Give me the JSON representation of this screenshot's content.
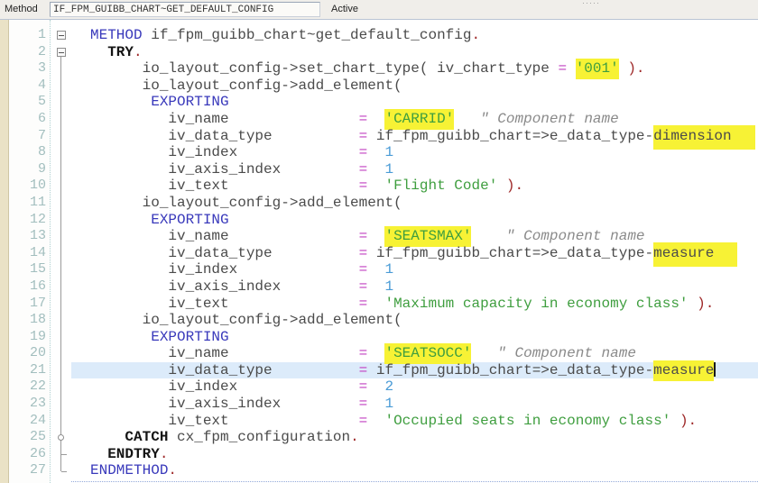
{
  "header": {
    "field_label": "Method",
    "field_value": "IF_FPM_GUIBB_CHART~GET_DEFAULT_CONFIG",
    "status": "Active",
    "splitter_dots": "·····"
  },
  "editor": {
    "active_line": 21,
    "colors": {
      "keyword": "#3939bb",
      "keyword_bold": "#141414",
      "identifier": "#4b4b4b",
      "string": "#3f9e3f",
      "number": "#4a9bd6",
      "operator": "#c240c2",
      "statement_end": "#9e2828",
      "comment": "#8a8a8a",
      "occurrence_highlight": "#f7f235",
      "active_line_bg": "#dcebfa",
      "line_number": "#a2bebe"
    },
    "fold": {
      "scope_line": {
        "from_line": 2,
        "to_line": 27
      },
      "markers": [
        {
          "line": 1,
          "type": "box"
        },
        {
          "line": 2,
          "type": "box"
        },
        {
          "line": 25,
          "type": "circle"
        },
        {
          "line": 26,
          "type": "tick"
        },
        {
          "line": 27,
          "type": "tick"
        }
      ]
    },
    "lines": [
      {
        "num": 1,
        "tokens": [
          {
            "c": "kw",
            "s": "METHOD"
          },
          {
            "c": "id",
            "s": " if_fpm_guibb_chart~get_default_config"
          },
          {
            "c": "dot",
            "s": "."
          }
        ]
      },
      {
        "num": 2,
        "tokens": [
          {
            "c": "kwb",
            "s": "  TRY"
          },
          {
            "c": "dot",
            "s": "."
          }
        ]
      },
      {
        "num": 3,
        "tokens": [
          {
            "c": "id",
            "s": "      io_layout_config->set_chart_type( iv_chart_type "
          },
          {
            "c": "op",
            "s": "="
          },
          {
            "c": "id",
            "s": " "
          },
          {
            "c": "str",
            "s": "'001'",
            "h": 1
          },
          {
            "c": "id",
            "s": " "
          },
          {
            "c": "dot",
            "s": ")."
          }
        ]
      },
      {
        "num": 4,
        "tokens": [
          {
            "c": "id",
            "s": "      io_layout_config->add_element("
          }
        ]
      },
      {
        "num": 5,
        "tokens": [
          {
            "c": "kw",
            "s": "       EXPORTING"
          }
        ]
      },
      {
        "num": 6,
        "tokens": [
          {
            "c": "id",
            "s": "         iv_name               "
          },
          {
            "c": "op",
            "s": "="
          },
          {
            "c": "id",
            "s": "  "
          },
          {
            "c": "str",
            "s": "'CARRID'",
            "h": 1
          },
          {
            "c": "id",
            "s": "   "
          },
          {
            "c": "cmt",
            "s": "\" Component name"
          }
        ]
      },
      {
        "num": 7,
        "tokens": [
          {
            "c": "id",
            "s": "         iv_data_type          "
          },
          {
            "c": "op",
            "s": "="
          },
          {
            "c": "id",
            "s": " if_fpm_guibb_chart=>e_data_type-"
          },
          {
            "c": "id",
            "s": "dimension",
            "h": 2
          }
        ]
      },
      {
        "num": 8,
        "tokens": [
          {
            "c": "id",
            "s": "         iv_index              "
          },
          {
            "c": "op",
            "s": "="
          },
          {
            "c": "id",
            "s": "  "
          },
          {
            "c": "num",
            "s": "1"
          }
        ]
      },
      {
        "num": 9,
        "tokens": [
          {
            "c": "id",
            "s": "         iv_axis_index         "
          },
          {
            "c": "op",
            "s": "="
          },
          {
            "c": "id",
            "s": "  "
          },
          {
            "c": "num",
            "s": "1"
          }
        ]
      },
      {
        "num": 10,
        "tokens": [
          {
            "c": "id",
            "s": "         iv_text               "
          },
          {
            "c": "op",
            "s": "="
          },
          {
            "c": "id",
            "s": "  "
          },
          {
            "c": "str",
            "s": "'Flight Code'"
          },
          {
            "c": "id",
            "s": " "
          },
          {
            "c": "dot",
            "s": ")."
          }
        ]
      },
      {
        "num": 11,
        "tokens": [
          {
            "c": "id",
            "s": "      io_layout_config->add_element("
          }
        ]
      },
      {
        "num": 12,
        "tokens": [
          {
            "c": "kw",
            "s": "       EXPORTING"
          }
        ]
      },
      {
        "num": 13,
        "tokens": [
          {
            "c": "id",
            "s": "         iv_name               "
          },
          {
            "c": "op",
            "s": "="
          },
          {
            "c": "id",
            "s": "  "
          },
          {
            "c": "str",
            "s": "'SEATSMAX'",
            "h": 1
          },
          {
            "c": "id",
            "s": "    "
          },
          {
            "c": "cmt",
            "s": "\" Component name"
          }
        ]
      },
      {
        "num": 14,
        "tokens": [
          {
            "c": "id",
            "s": "         iv_data_type          "
          },
          {
            "c": "op",
            "s": "="
          },
          {
            "c": "id",
            "s": " if_fpm_guibb_chart=>e_data_type-"
          },
          {
            "c": "id",
            "s": "measure",
            "h": 2
          }
        ]
      },
      {
        "num": 15,
        "tokens": [
          {
            "c": "id",
            "s": "         iv_index              "
          },
          {
            "c": "op",
            "s": "="
          },
          {
            "c": "id",
            "s": "  "
          },
          {
            "c": "num",
            "s": "1"
          }
        ]
      },
      {
        "num": 16,
        "tokens": [
          {
            "c": "id",
            "s": "         iv_axis_index         "
          },
          {
            "c": "op",
            "s": "="
          },
          {
            "c": "id",
            "s": "  "
          },
          {
            "c": "num",
            "s": "1"
          }
        ]
      },
      {
        "num": 17,
        "tokens": [
          {
            "c": "id",
            "s": "         iv_text               "
          },
          {
            "c": "op",
            "s": "="
          },
          {
            "c": "id",
            "s": "  "
          },
          {
            "c": "str",
            "s": "'Maximum capacity in economy class'"
          },
          {
            "c": "id",
            "s": " "
          },
          {
            "c": "dot",
            "s": ")."
          }
        ]
      },
      {
        "num": 18,
        "tokens": [
          {
            "c": "id",
            "s": "      io_layout_config->add_element("
          }
        ]
      },
      {
        "num": 19,
        "tokens": [
          {
            "c": "kw",
            "s": "       EXPORTING"
          }
        ]
      },
      {
        "num": 20,
        "tokens": [
          {
            "c": "id",
            "s": "         iv_name               "
          },
          {
            "c": "op",
            "s": "="
          },
          {
            "c": "id",
            "s": "  "
          },
          {
            "c": "str",
            "s": "'SEATSOCC'",
            "h": 1
          },
          {
            "c": "id",
            "s": "   "
          },
          {
            "c": "cmt",
            "s": "\" Component name"
          }
        ]
      },
      {
        "num": 21,
        "tokens": [
          {
            "c": "id",
            "s": "         iv_data_type          "
          },
          {
            "c": "op",
            "s": "="
          },
          {
            "c": "id",
            "s": " if_fpm_guibb_chart=>e_data_type-"
          },
          {
            "c": "id",
            "s": "measure",
            "h": 1,
            "cur": 1
          }
        ]
      },
      {
        "num": 22,
        "tokens": [
          {
            "c": "id",
            "s": "         iv_index              "
          },
          {
            "c": "op",
            "s": "="
          },
          {
            "c": "id",
            "s": "  "
          },
          {
            "c": "num",
            "s": "2"
          }
        ]
      },
      {
        "num": 23,
        "tokens": [
          {
            "c": "id",
            "s": "         iv_axis_index         "
          },
          {
            "c": "op",
            "s": "="
          },
          {
            "c": "id",
            "s": "  "
          },
          {
            "c": "num",
            "s": "1"
          }
        ]
      },
      {
        "num": 24,
        "tokens": [
          {
            "c": "id",
            "s": "         iv_text               "
          },
          {
            "c": "op",
            "s": "="
          },
          {
            "c": "id",
            "s": "  "
          },
          {
            "c": "str",
            "s": "'Occupied seats in economy class'"
          },
          {
            "c": "id",
            "s": " "
          },
          {
            "c": "dot",
            "s": ")."
          }
        ]
      },
      {
        "num": 25,
        "tokens": [
          {
            "c": "kwb",
            "s": "    CATCH"
          },
          {
            "c": "id",
            "s": " cx_fpm_configuration"
          },
          {
            "c": "dot",
            "s": "."
          }
        ]
      },
      {
        "num": 26,
        "tokens": [
          {
            "c": "kwb",
            "s": "  ENDTRY"
          },
          {
            "c": "dot",
            "s": "."
          }
        ]
      },
      {
        "num": 27,
        "tokens": [
          {
            "c": "kw",
            "s": "ENDMETHOD"
          },
          {
            "c": "dot",
            "s": "."
          }
        ]
      }
    ]
  }
}
